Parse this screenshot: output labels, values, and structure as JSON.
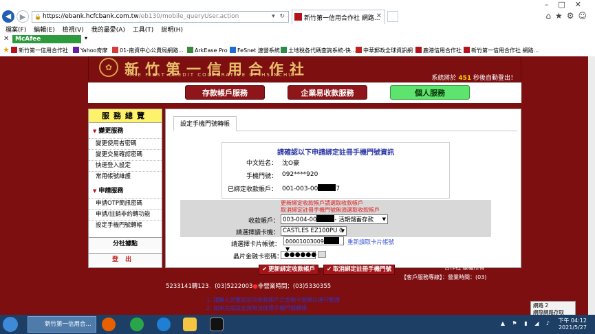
{
  "browser": {
    "url_prefix": "https://ebank.hcfcbank.com.tw",
    "url_path": "/eb130/mobile_queryUser.action",
    "tab_title": "新竹第一信用合作社 網路...",
    "menu": [
      "檔案(F)",
      "編輯(E)",
      "檢視(V)",
      "我的最愛(A)",
      "工具(T)",
      "說明(H)"
    ],
    "mcafee": "McAfee",
    "favorites": [
      "新竹第一信用合作社",
      "Yahoo奇摩",
      "01-南資中心公費局網路...",
      "ArkEase Pro",
      "FeSnet 連營系統",
      "土地稅各代碼查詢系統-快...",
      "中華郵政全球資訊網",
      "鹿港信用合作社",
      "新竹第一信用合作社 網路..."
    ]
  },
  "banner": {
    "name": "新竹第一信用合作社",
    "english": "THE FIRST CREDIT COOPERATIVE OF HSINCHU",
    "logout_prefix": "系統將於",
    "logout_seconds": "451",
    "logout_suffix": "秒後自動登出！"
  },
  "services": [
    "存款帳戶服務",
    "企業易收款服務",
    "個人服務"
  ],
  "sidebar": {
    "header": "服務總覽",
    "group1": "變更服務",
    "group1_items": [
      "變更使用者密碼",
      "變更交易確認密碼",
      "快速登入設定",
      "常用帳號維護"
    ],
    "group2": "申請服務",
    "group2_items": [
      "申請OTP簡訊密碼",
      "申請/註銷非約轉功能",
      "設定手機門號轉帳"
    ],
    "branch": "分社據點",
    "logout": "登出"
  },
  "content": {
    "tab": "設定手機門號轉帳",
    "box_title": "請確認以下申請綁定註冊手機門號資訊",
    "rows": [
      {
        "label": "中文姓名：",
        "value": "沈O豪"
      },
      {
        "label": "手機門號：",
        "value": "092****920"
      },
      {
        "label": "已綁定收款帳戶：",
        "value_a": "001-003-00",
        "value_b": "7"
      }
    ],
    "note1": "更新綁定收款帳戶請選取收款帳戶",
    "note2": "取消綁定註冊手機門號無須選取收款帳戶",
    "account_label": "收款帳戶：",
    "account_value_a": "003-004-00",
    "account_value_b": "- 活期儲蓄存款",
    "reader_label": "請選擇讀卡機：",
    "reader_value": "CASTLES EZ100PU 0",
    "card_label": "請選擇卡片帳號：",
    "card_value": "00001003009",
    "reread": "重新讀取卡片帳號",
    "pin_label": "晶片金融卡密碼：",
    "pin_value": "●●●●●●",
    "btn_update": "更新綁定收款帳戶",
    "btn_cancel": "取消綁定註冊手機門號"
  },
  "footer": {
    "copyright1": "©2012 新竹第一信用",
    "copyright2": "合作社 版權所有",
    "hotline": "【客戶服務專線】：營業時間：(03)",
    "phones_a": "5233141轉123",
    "phones_b": "(03)5222003",
    "phones_c": "非營業時間：(03)5330355",
    "hint1": "1.  請輸入您要設定的收款帳戶之金融卡密碼以進行驗證",
    "hint2": "2.  如未完成設定將無法使用手機門號轉帳"
  },
  "popup": {
    "line1": "網路 2",
    "line2": "網際網路存取"
  },
  "taskbar": {
    "ie_label": "新竹第一信用合...",
    "time": "下午 04:12",
    "date": "2021/5/27"
  }
}
